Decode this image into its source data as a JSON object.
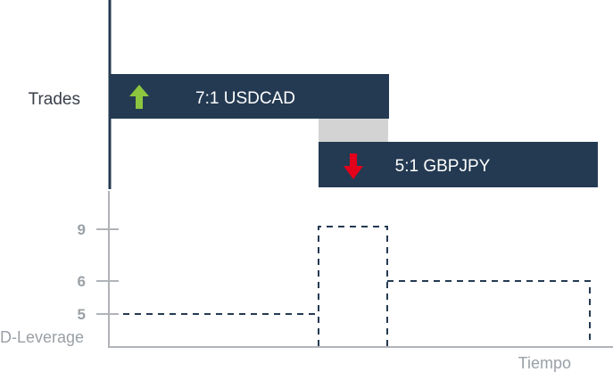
{
  "upper_panel": {
    "label": "Trades",
    "trades": [
      {
        "text": "7:1 USDCAD",
        "direction": "up",
        "arrow_icon": "arrow-up-icon",
        "arrow_color": "#8cc63f"
      },
      {
        "text": "5:1 GBPJPY",
        "direction": "down",
        "arrow_icon": "arrow-down-icon",
        "arrow_color": "#e3001b"
      }
    ],
    "trade_bar_color": "#243a52",
    "overlap_color": "#d3d3d3"
  },
  "lower_panel": {
    "y_ticks": [
      "9",
      "6",
      "5"
    ],
    "y_label": "D-Leverage",
    "x_label": "Tiempo",
    "line_color": "#243a52",
    "axis_color": "#b0b3b8"
  }
}
